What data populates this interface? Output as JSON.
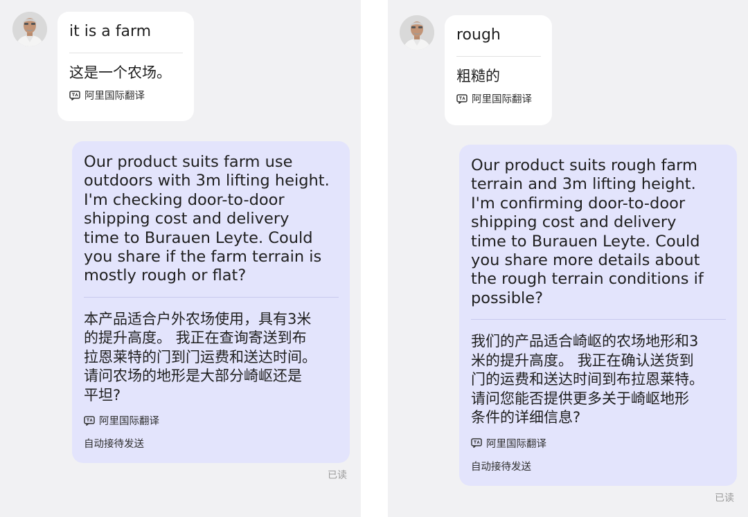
{
  "panels": [
    {
      "incoming": {
        "original": "it is a farm",
        "translation": "这是一个农场。",
        "translator_label": "阿里国际翻译"
      },
      "outgoing": {
        "original": "Our product suits farm use\noutdoors with 3m lifting height.\nI'm checking door-to-door\nshipping cost and delivery\ntime to Burauen Leyte. Could\nyou share if the farm terrain is\nmostly rough or flat?",
        "translation": "本产品适合户外农场使用，具有3米\n的提升高度。 我正在查询寄送到布\n拉恩莱特的门到门运费和送达时间。\n请问农场的地形是大部分崎岖还是\n平坦?",
        "translator_label": "阿里国际翻译",
        "auto_send_label": "自动接待发送",
        "read_status": "已读"
      }
    },
    {
      "incoming": {
        "original": "rough",
        "translation": "粗糙的",
        "translator_label": "阿里国际翻译"
      },
      "outgoing": {
        "original": "Our product suits rough farm\nterrain and 3m lifting height.\nI'm confirming door-to-door\nshipping cost and delivery\ntime to Burauen Leyte. Could\nyou share more details about\nthe rough terrain conditions if\npossible?",
        "translation": "我们的产品适合崎岖的农场地形和3\n米的提升高度。 我正在确认送货到\n门的运费和送达时间到布拉恩莱特。\n请问您能否提供更多关于崎岖地形\n条件的详细信息?",
        "translator_label": "阿里国际翻译",
        "auto_send_label": "自动接待发送",
        "read_status": "已读"
      }
    }
  ],
  "icons": {
    "avatar": "avatar-photo",
    "translator": "translate-icon"
  },
  "colors": {
    "background": "#f1f1f3",
    "incoming_bubble": "#ffffff",
    "outgoing_bubble": "#e3e4fc",
    "read_status": "#9a9a9a"
  }
}
